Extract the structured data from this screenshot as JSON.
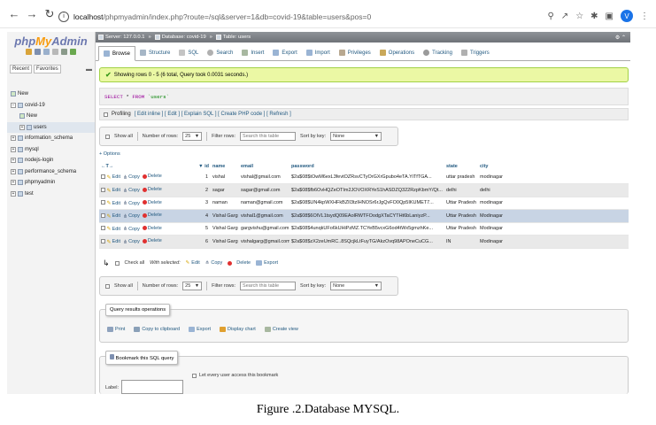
{
  "browser": {
    "url_host": "localhost",
    "url_path": "/phpmyadmin/index.php?route=/sql&server=1&db=covid-19&table=users&pos=0",
    "avatar_letter": "V"
  },
  "sidebar": {
    "logo_php": "php",
    "logo_my": "My",
    "logo_admin": "Admin",
    "tab_recent": "Recent",
    "tab_favorites": "Favorites",
    "tree": [
      {
        "label": "New"
      },
      {
        "label": "covid-19"
      },
      {
        "label": "New"
      },
      {
        "label": "users"
      },
      {
        "label": "information_schema"
      },
      {
        "label": "mysql"
      },
      {
        "label": "nodejs-login"
      },
      {
        "label": "performance_schema"
      },
      {
        "label": "phpmyadmin"
      },
      {
        "label": "test"
      }
    ]
  },
  "serverbar": {
    "server": "Server: 127.0.0.1",
    "database": "Database: covid-19",
    "table": "Table: users"
  },
  "menu": {
    "browse": "Browse",
    "structure": "Structure",
    "sql": "SQL",
    "search": "Search",
    "insert": "Insert",
    "export": "Export",
    "import": "Import",
    "privileges": "Privileges",
    "operations": "Operations",
    "tracking": "Tracking",
    "triggers": "Triggers"
  },
  "message": "Showing rows 0 - 5 (6 total, Query took 0.0031 seconds.)",
  "sql": {
    "select": "SELECT",
    "star": " * ",
    "from": "FROM",
    "table": " `users`"
  },
  "profiling": {
    "label": "Profiling",
    "links": "[ Edit inline ] [ Edit ] [ Explain SQL ] [ Create PHP code ] [ Refresh ]"
  },
  "nav": {
    "show_all": "Show all",
    "rows_label": "Number of rows:",
    "rows_value": "25",
    "filter_label": "Filter rows:",
    "filter_placeholder": "Search this table",
    "sort_label": "Sort by key:",
    "sort_value": "None"
  },
  "options_label": "+ Options",
  "table": {
    "headers": [
      "id",
      "name",
      "email",
      "password",
      "state",
      "city"
    ],
    "rows": [
      {
        "id": "1",
        "name": "vishal",
        "email": "vishal@gmail.com",
        "password": "$2a$08$tOwM6exL3fevtOZRsvCTyOrGXrGpubo4eTA.YiTfTGA...",
        "state": "uttar pradesh",
        "city": "modinagar"
      },
      {
        "id": "2",
        "name": "sagar",
        "email": "sagar@gmail.com",
        "password": "$2a$08$fb6OvHQZeOTIm2JOVOXRYeS1hASDZQ322RzpKbmY/Qt...",
        "state": "delhi",
        "city": "delhi"
      },
      {
        "id": "3",
        "name": "naman",
        "email": "naman@gmail.com",
        "password": "$2a$08$UN4kpWXHFkBZlI3tzIHNOSr6rJgQvFO0Qp5IKUMET7...",
        "state": "Uttar Pradesh",
        "city": "modinagar"
      },
      {
        "id": "4",
        "name": "Vishal Garg",
        "email": "vishal1@gmail.com",
        "password": "$2a$08$6OlVL1tsydQ09EAolRWTFOodgXTaCYTHt6bLaniyzP...",
        "state": "Uttar Pradesh",
        "city": "Modinagar"
      },
      {
        "id": "5",
        "name": "Vishal Garg",
        "email": "gargvishu@gmail.com",
        "password": "$2a$08$4unqkUFo6kUHiPzMZ.TCYeB5vcxG6od4tWx5gmzhKe...",
        "state": "Uttar Pradesh",
        "city": "Modinagar"
      },
      {
        "id": "6",
        "name": "Vishal Garg",
        "email": "vishalgarg@gmail.com",
        "password": "$2a$08$zX2zeUmRC..8SQcjkLtFuyTG/AkzOvq98APOneCuCG...",
        "state": "IN",
        "city": "Modinagar"
      }
    ],
    "edit": "Edit",
    "copy": "Copy",
    "delete": "Delete"
  },
  "with_selected": {
    "check_all": "Check all",
    "label": "With selected:",
    "edit": "Edit",
    "copy": "Copy",
    "delete": "Delete",
    "export": "Export"
  },
  "query_ops": {
    "legend": "Query results operations",
    "print": "Print",
    "copy_clipboard": "Copy to clipboard",
    "export": "Export",
    "display_chart": "Display chart",
    "create_view": "Create view"
  },
  "bookmark": {
    "legend": "Bookmark this SQL query",
    "label": "Label:",
    "let_every_user": "Let every user access this bookmark"
  },
  "caption": "Figure .2.Database MYSQL."
}
